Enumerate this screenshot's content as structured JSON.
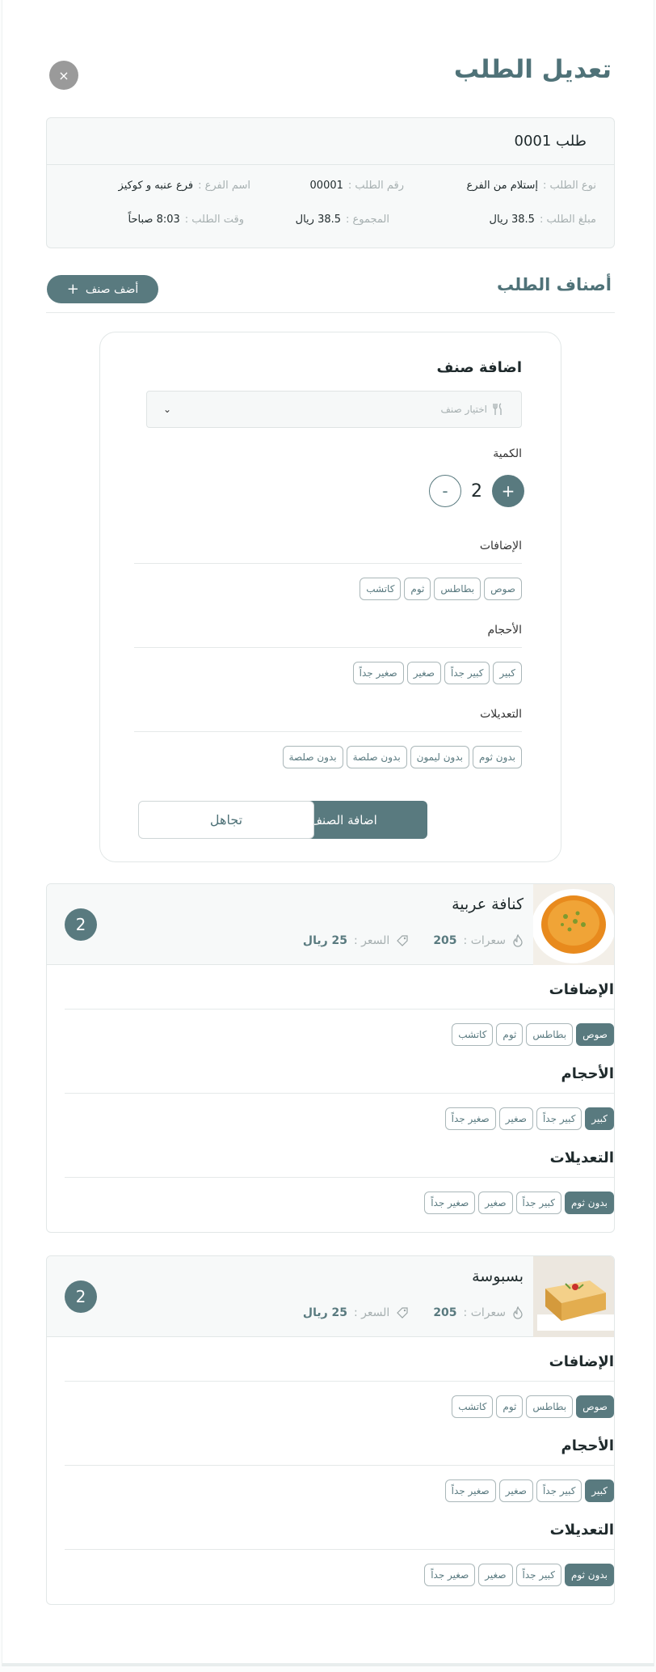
{
  "page_title": "تعديل الطلب",
  "close_symbol": "×",
  "order": {
    "name": "طلب 0001",
    "type_label": "نوع الطلب :",
    "type_value": "إستلام من الفرع",
    "number_label": "رقم الطلب :",
    "number_value": "00001",
    "branch_label": "اسم الفرع :",
    "branch_value": "فرع عنبه و كوكيز",
    "amount_label": "مبلغ الطلب :",
    "amount_value": "38.5 ريال",
    "total_label": "المجموع :",
    "total_value": "38.5 ريال",
    "time_label": "وقت الطلب :",
    "time_value": "8:03 صباحاً"
  },
  "items_section_title": "أصناف الطلب",
  "add_item_button": "أضف صنف",
  "add_form": {
    "heading": "اضافة صنف",
    "select_placeholder": "اختيار صنف",
    "quantity_label": "الكمية",
    "quantity_value": "2",
    "minus": "-",
    "plus": "+",
    "extras_label": "الإضافات",
    "extras": [
      "صوص",
      "بطاطس",
      "ثوم",
      "كاتشب"
    ],
    "sizes_label": "الأحجام",
    "sizes": [
      "كبير",
      "كبير جداً",
      "صغير",
      "صغير جداً"
    ],
    "mods_label": "التعديلات",
    "mods": [
      "بدون ثوم",
      "بدون ليمون",
      "بدون صلصة",
      "بدون صلصة"
    ],
    "submit_label": "اضافة الصنف للطلب",
    "ignore_label": "تجاهل"
  },
  "order_items": [
    {
      "name": "كنافة عربية",
      "calories_label": "سعرات :",
      "calories": "205",
      "price_label": "السعر :",
      "price": "25 ريال",
      "qty": "2",
      "image": "kunafa",
      "extras_label": "الإضافات",
      "extras": [
        "صوص",
        "بطاطس",
        "ثوم",
        "كاتشب"
      ],
      "extras_selected": [
        0
      ],
      "sizes_label": "الأحجام",
      "sizes": [
        "كبير",
        "كبير جداً",
        "صغير",
        "صغير جداً"
      ],
      "sizes_selected": [
        0
      ],
      "mods_label": "التعديلات",
      "mods": [
        "بدون ثوم",
        "كبير جداً",
        "صغير",
        "صغير جداً"
      ],
      "mods_selected": [
        0
      ]
    },
    {
      "name": "بسبوسة",
      "calories_label": "سعرات :",
      "calories": "205",
      "price_label": "السعر :",
      "price": "25 ريال",
      "qty": "2",
      "image": "basbousa",
      "extras_label": "الإضافات",
      "extras": [
        "صوص",
        "بطاطس",
        "ثوم",
        "كاتشب"
      ],
      "extras_selected": [
        0
      ],
      "sizes_label": "الأحجام",
      "sizes": [
        "كبير",
        "كبير جداً",
        "صغير",
        "صغير جداً"
      ],
      "sizes_selected": [
        0
      ],
      "mods_label": "التعديلات",
      "mods": [
        "بدون ثوم",
        "كبير جداً",
        "صغير",
        "صغير جداً"
      ],
      "mods_selected": [
        0
      ]
    }
  ],
  "colors": {
    "accent": "#597a7f",
    "title": "#4f7278",
    "close": "#9a9a9a"
  }
}
